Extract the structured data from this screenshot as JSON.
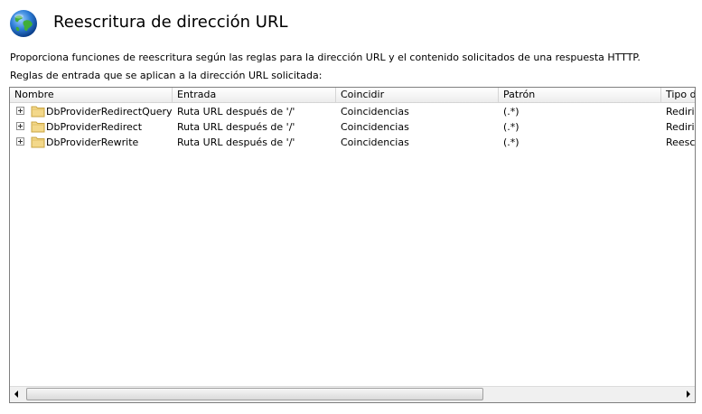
{
  "title": "Reescritura de dirección URL",
  "description": "Proporciona funciones de reescritura según las reglas para la dirección URL y el contenido solicitados de una respuesta HTTTP.",
  "rules_caption": "Reglas de entrada que se aplican a la dirección URL solicitada:",
  "columns": [
    "Nombre",
    "Entrada",
    "Coincidir",
    "Patrón",
    "Tipo de"
  ],
  "rows": [
    {
      "name": "DbProviderRedirectQuery",
      "input": "Ruta URL después de '/'",
      "match": "Coincidencias",
      "pattern": "(.*)",
      "type": "Redirig"
    },
    {
      "name": "DbProviderRedirect",
      "input": "Ruta URL después de '/'",
      "match": "Coincidencias",
      "pattern": "(.*)",
      "type": "Redirig"
    },
    {
      "name": "DbProviderRewrite",
      "input": "Ruta URL después de '/'",
      "match": "Coincidencias",
      "pattern": "(.*)",
      "type": "Reescri"
    }
  ],
  "icons": {
    "feature": "globe-icon",
    "expand": "expand-plus-icon",
    "rule": "folder-icon",
    "scroll_left": "scroll-left-arrow-icon",
    "scroll_right": "scroll-right-arrow-icon"
  }
}
